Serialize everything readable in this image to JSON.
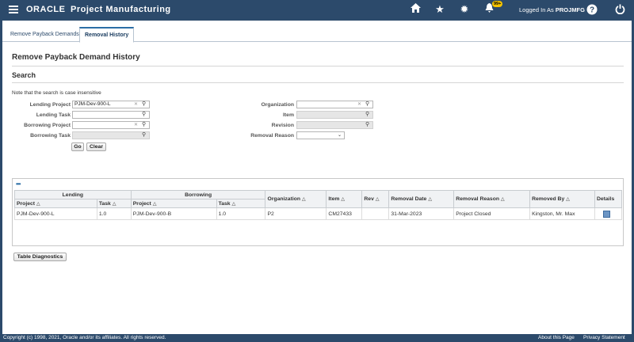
{
  "header": {
    "brand": "ORACLE",
    "app_name": "Project Manufacturing",
    "notification_count": "99+",
    "logged_in_prefix": "Logged In As",
    "username": "PROJMFG"
  },
  "tabs": [
    {
      "label": "Remove Payback Demands"
    },
    {
      "label": "Removal History"
    }
  ],
  "page": {
    "title": "Remove Payback Demand History",
    "search_title": "Search",
    "note": "Note that the search is case insensitive"
  },
  "form": {
    "lending_project": {
      "label": "Lending Project",
      "value": "PJM-Dev-900-L"
    },
    "lending_task": {
      "label": "Lending Task",
      "value": ""
    },
    "borrowing_project": {
      "label": "Borrowing Project",
      "value": ""
    },
    "borrowing_task": {
      "label": "Borrowing Task",
      "value": ""
    },
    "organization": {
      "label": "Organization",
      "value": ""
    },
    "item": {
      "label": "Item",
      "value": ""
    },
    "revision": {
      "label": "Revision",
      "value": ""
    },
    "removal_reason": {
      "label": "Removal Reason",
      "value": ""
    },
    "go_label": "Go",
    "clear_label": "Clear"
  },
  "table": {
    "group_lending": "Lending",
    "group_borrowing": "Borrowing",
    "columns": {
      "lend_project": "Project",
      "lend_task": "Task",
      "borr_project": "Project",
      "borr_task": "Task",
      "organization": "Organization",
      "item": "Item",
      "rev": "Rev",
      "removal_date": "Removal Date",
      "removal_reason": "Removal Reason",
      "removed_by": "Removed By",
      "details": "Details"
    },
    "rows": [
      {
        "lend_project": "PJM-Dev-900-L",
        "lend_task": "1.0",
        "borr_project": "PJM-Dev-900-B",
        "borr_task": "1.0",
        "organization": "P2",
        "item": "CM27433",
        "rev": "",
        "removal_date": "31-Mar-2023",
        "removal_reason": "Project Closed",
        "removed_by": "Kingston, Mr. Max"
      }
    ]
  },
  "diagnostics_label": "Table Diagnostics",
  "footer": {
    "copyright": "Copyright (c) 1998, 2021, Oracle and/or its affiliates. All rights reserved.",
    "about": "About this Page",
    "privacy": "Privacy Statement"
  }
}
